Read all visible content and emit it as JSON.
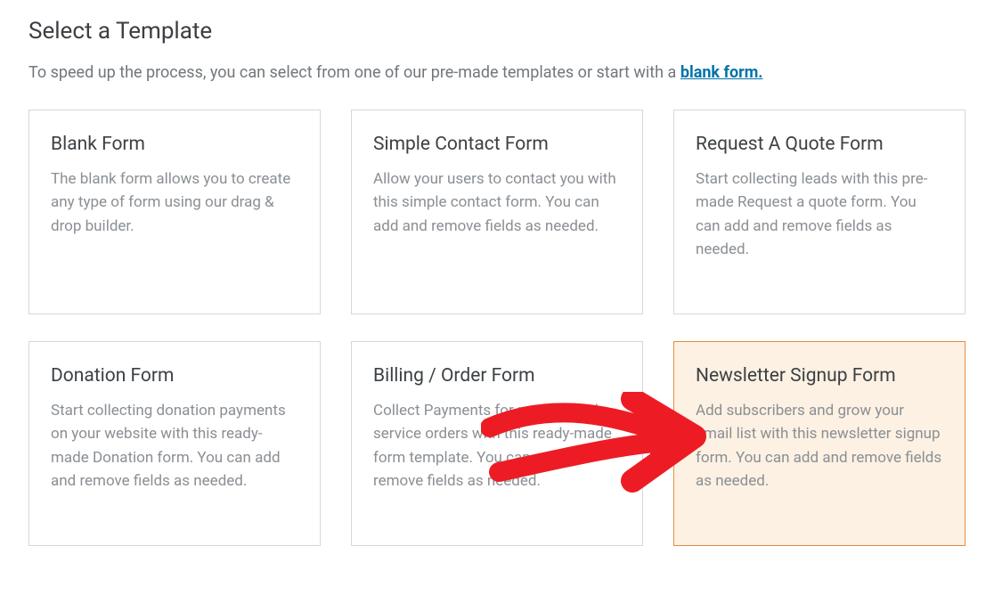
{
  "header": {
    "title": "Select a Template",
    "subtitle_prefix": "To speed up the process, you can select from one of our pre-made templates or start with a ",
    "blank_link_text": "blank form."
  },
  "templates": [
    {
      "title": "Blank Form",
      "desc": "The blank form allows you to create any type of form using our drag & drop builder.",
      "highlighted": false
    },
    {
      "title": "Simple Contact Form",
      "desc": "Allow your users to contact you with this simple contact form. You can add and remove fields as needed.",
      "highlighted": false
    },
    {
      "title": "Request A Quote Form",
      "desc": "Start collecting leads with this pre-made Request a quote form. You can add and remove fields as needed.",
      "highlighted": false
    },
    {
      "title": "Donation Form",
      "desc": "Start collecting donation payments on your website with this ready-made Donation form. You can add and remove fields as needed.",
      "highlighted": false
    },
    {
      "title": "Billing / Order Form",
      "desc": "Collect Payments for product and service orders with this ready-made form template. You can add and remove fields as needed.",
      "highlighted": false
    },
    {
      "title": "Newsletter Signup Form",
      "desc": "Add subscribers and grow your email list with this newsletter signup form. You can add and remove fields as needed.",
      "highlighted": true
    }
  ]
}
